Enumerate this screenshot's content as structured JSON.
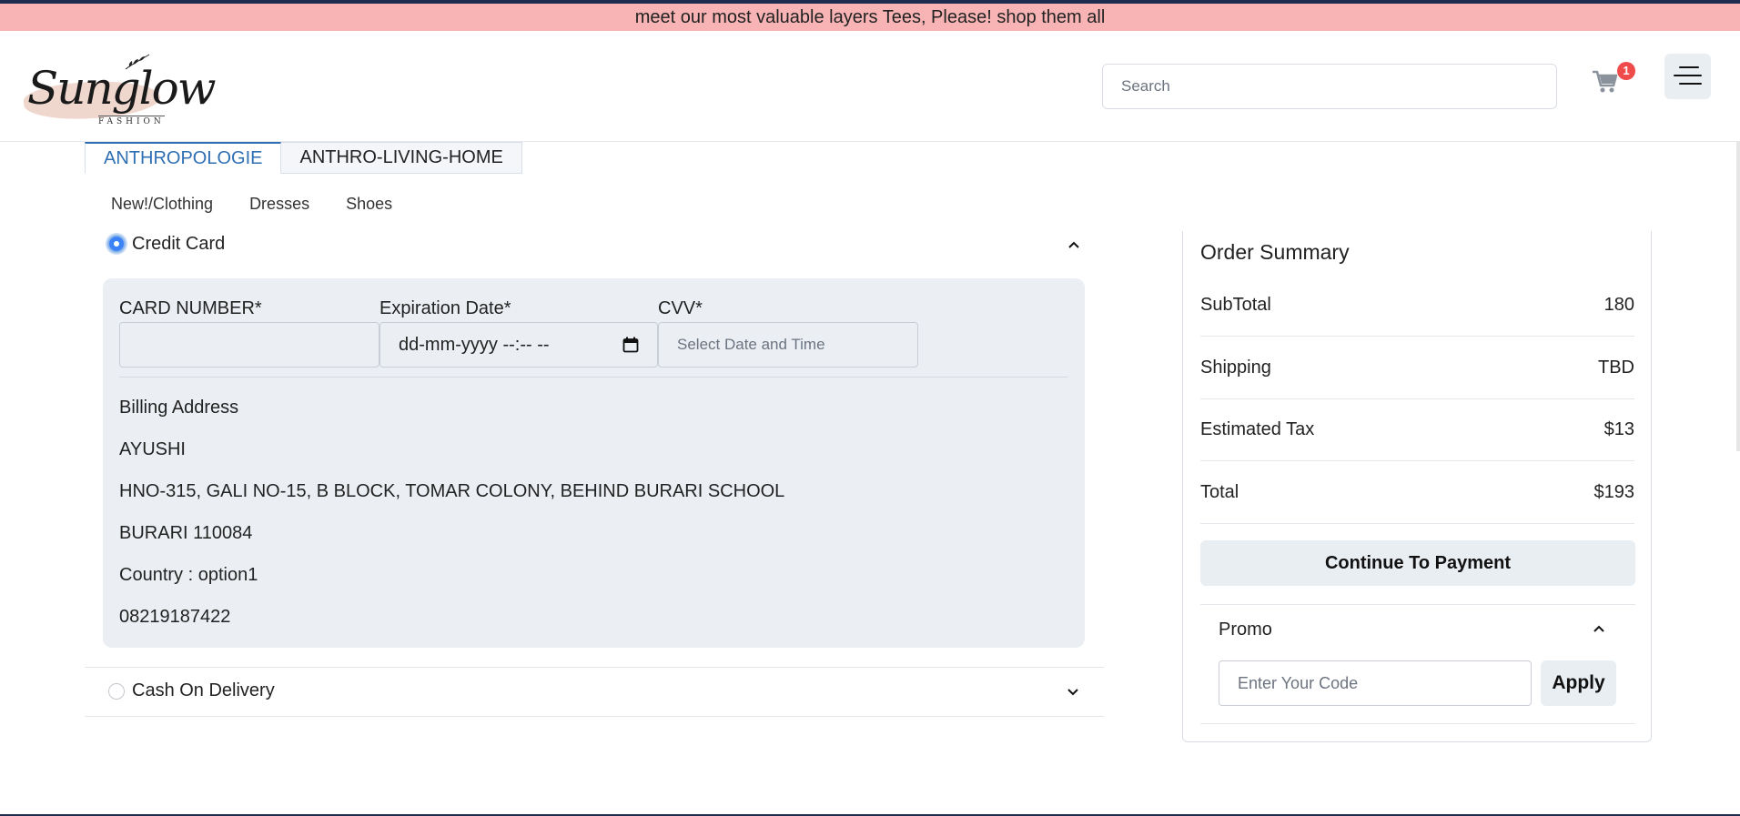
{
  "banner": {
    "text": "meet our most valuable layers Tees, Please! shop them all"
  },
  "header": {
    "logo": {
      "script": "Sunglow",
      "sub": "FASHION"
    },
    "search": {
      "placeholder": "Search",
      "value": ""
    },
    "cart": {
      "count": "1",
      "icon": "cart-icon"
    },
    "menu": {
      "icon": "hamburger-menu-icon"
    }
  },
  "tabs": [
    {
      "label": "ANTHROPOLOGIE",
      "active": true
    },
    {
      "label": "ANTHRO-LIVING-HOME",
      "active": false
    }
  ],
  "subnav": [
    "New!/Clothing",
    "Dresses",
    "Shoes"
  ],
  "payment": {
    "credit_card": {
      "label": "Credit Card",
      "selected": true,
      "card_number_label": "CARD NUMBER*",
      "card_number_value": "",
      "expiration_label": "Expiration Date*",
      "expiration_value": "dd-mm-yyyy --:-- --",
      "cvv_label": "CVV*",
      "cvv_placeholder": "Select Date and Time",
      "billing": {
        "heading": "Billing Address",
        "name": "AYUSHI",
        "street": "HNO-315, GALI NO-15, B BLOCK, TOMAR COLONY, BEHIND BURARI SCHOOL",
        "city": "BURARI 110084",
        "country": "Country : option1",
        "phone": "08219187422"
      }
    },
    "cod": {
      "label": "Cash On Delivery",
      "selected": false
    }
  },
  "summary": {
    "title": "Order Summary",
    "rows": [
      {
        "label": "SubTotal",
        "value": "180"
      },
      {
        "label": "Shipping",
        "value": "TBD"
      },
      {
        "label": "Estimated Tax",
        "value": "$13"
      },
      {
        "label": "Total",
        "value": "$193"
      }
    ],
    "continue_label": "Continue To Payment",
    "promo": {
      "title": "Promo",
      "placeholder": "Enter Your Code",
      "apply_label": "Apply"
    }
  },
  "colors": {
    "banner": "#f8b4b4",
    "accent": "#2f6fb3",
    "badge": "#ef4b4b",
    "panel": "#ebeff4"
  }
}
